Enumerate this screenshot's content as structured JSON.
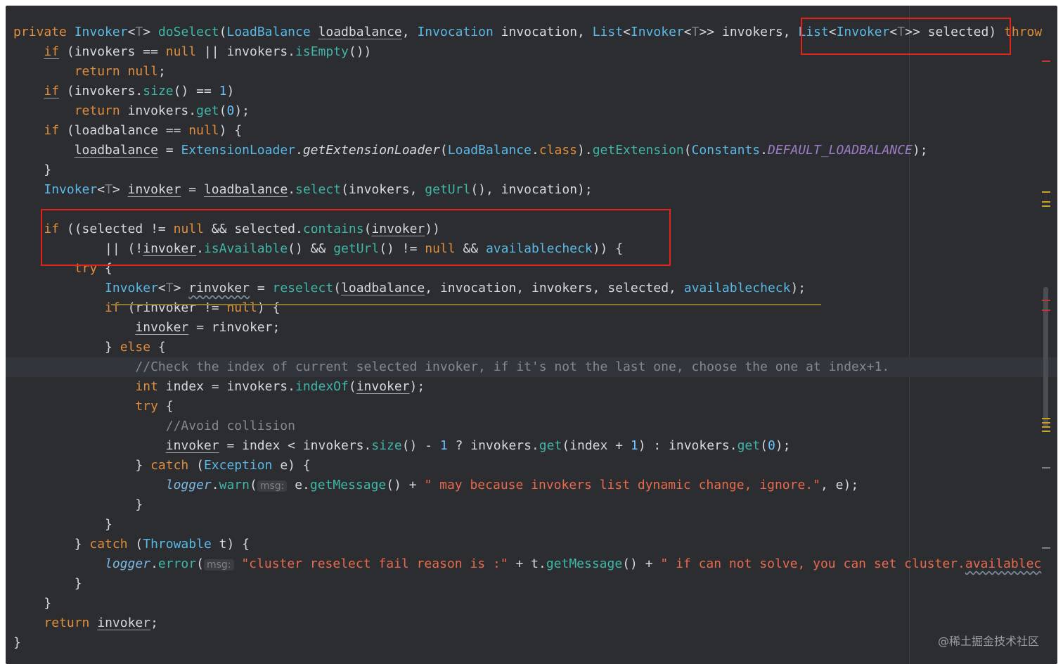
{
  "code": {
    "l01a": "private ",
    "l01b": "Invoker",
    "l01c": "<",
    "l01d": "T",
    "l01e": "> ",
    "l01f": "doSelect",
    "l01g": "(",
    "l01h": "LoadBalance",
    "l01i": " ",
    "l01j": "loadbalance",
    "l01k": ", ",
    "l01l": "Invocation",
    "l01m": " invocation, ",
    "l01n": "List",
    "l01o": "<",
    "l01p": "Invoker",
    "l01q": "<",
    "l01r": "T",
    "l01s": ">> invokers, ",
    "l01t": "List",
    "l01u": "<",
    "l01v": "Invoker",
    "l01w": "<",
    "l01x": "T",
    "l01y": ">> selected) ",
    "l01z": "throw",
    "l02a": "    ",
    "l02b": "if",
    "l02c": " (invokers == ",
    "l02d": "null",
    "l02e": " || invokers.",
    "l02f": "isEmpty",
    "l02g": "())",
    "l03a": "        ",
    "l03b": "return",
    "l03c": " ",
    "l03d": "null",
    "l03e": ";",
    "l04a": "    ",
    "l04b": "if",
    "l04c": " (invokers.",
    "l04d": "size",
    "l04e": "() == ",
    "l04f": "1",
    "l04g": ")",
    "l05a": "        ",
    "l05b": "return",
    "l05c": " invokers.",
    "l05d": "get",
    "l05e": "(",
    "l05f": "0",
    "l05g": ");",
    "l06a": "    ",
    "l06b": "if",
    "l06c": " (loadbalance == ",
    "l06d": "null",
    "l06e": ") {",
    "l07a": "        ",
    "l07b": "loadbalance",
    "l07c": " = ",
    "l07d": "ExtensionLoader",
    "l07e": ".",
    "l07f": "getExtensionLoader",
    "l07g": "(",
    "l07h": "LoadBalance",
    "l07i": ".",
    "l07j": "class",
    "l07k": ").",
    "l07l": "getExtension",
    "l07m": "(",
    "l07n": "Constants",
    "l07o": ".",
    "l07p": "DEFAULT_LOADBALANCE",
    "l07q": ");",
    "l08a": "    }",
    "l09a": "    ",
    "l09b": "Invoker",
    "l09c": "<",
    "l09d": "T",
    "l09e": "> ",
    "l09f": "invoker",
    "l09g": " = ",
    "l09h": "loadbalance",
    "l09i": ".",
    "l09j": "select",
    "l09k": "(invokers, ",
    "l09l": "getUrl",
    "l09m": "(), invocation);",
    "l11a": "    ",
    "l11b": "if",
    "l11c": " ((selected != ",
    "l11d": "null",
    "l11e": " && selected.",
    "l11f": "contains",
    "l11g": "(",
    "l11h": "invoker",
    "l11i": "))",
    "l12a": "            || (!",
    "l12b": "invoker",
    "l12c": ".",
    "l12d": "isAvailable",
    "l12e": "() && ",
    "l12f": "getUrl",
    "l12g": "() != ",
    "l12h": "null",
    "l12i": " && ",
    "l12j": "availablecheck",
    "l12k": ")) {",
    "l13a": "        ",
    "l13b": "try",
    "l13c": " {",
    "l14a": "            ",
    "l14b": "Invoker",
    "l14c": "<",
    "l14d": "T",
    "l14e": "> ",
    "l14f": "rinvoker",
    "l14g": " = ",
    "l14h": "reselect",
    "l14i": "(",
    "l14j": "loadbalance",
    "l14k": ", invocation, invokers, selected, ",
    "l14l": "availablecheck",
    "l14m": ");",
    "l15a": "            ",
    "l15b": "if",
    "l15c": " (rinvoker != ",
    "l15d": "null",
    "l15e": ") {",
    "l16a": "                ",
    "l16b": "invoker",
    "l16c": " = rinvoker;",
    "l17a": "            } ",
    "l17b": "else",
    "l17c": " {",
    "l18a": "                ",
    "l18b": "//Check the index of current selected invoker, if it's not the last one, choose the one at index+1.",
    "l19a": "                ",
    "l19b": "int",
    "l19c": " index = invokers.",
    "l19d": "indexOf",
    "l19e": "(",
    "l19f": "invoker",
    "l19g": ");",
    "l20a": "                ",
    "l20b": "try",
    "l20c": " {",
    "l21a": "                    ",
    "l21b": "//Avoid collision",
    "l22a": "                    ",
    "l22b": "invoker",
    "l22c": " = index < invokers.",
    "l22d": "size",
    "l22e": "() - ",
    "l22f": "1",
    "l22g": " ? invokers.",
    "l22h": "get",
    "l22i": "(index + ",
    "l22j": "1",
    "l22k": ") : invokers.",
    "l22l": "get",
    "l22m": "(",
    "l22n": "0",
    "l22o": ");",
    "l23a": "                } ",
    "l23b": "catch",
    "l23c": " (",
    "l23d": "Exception",
    "l23e": " e) {",
    "l24a": "                    ",
    "l24b": "logger",
    "l24c": ".",
    "l24d": "warn",
    "l24e": "(",
    "l24f": "msg:",
    "l24g": " e.",
    "l24h": "getMessage",
    "l24i": "() + ",
    "l24j": "\" may because invokers list dynamic change, ignore.\"",
    "l24k": ", e);",
    "l25a": "                }",
    "l26a": "            }",
    "l27a": "        } ",
    "l27b": "catch",
    "l27c": " (",
    "l27d": "Throwable",
    "l27e": " t) {",
    "l28a": "            ",
    "l28b": "logger",
    "l28c": ".",
    "l28d": "error",
    "l28e": "(",
    "l28f": "msg:",
    "l28g": " ",
    "l28h": "\"cluster reselect fail reason is :\"",
    "l28i": " + t.",
    "l28j": "getMessage",
    "l28k": "() + ",
    "l28l": "\" if can not solve, you can set cluster.",
    "l28m": "availablec",
    "l29a": "        }",
    "l30a": "    }",
    "l31a": "    ",
    "l31b": "return",
    "l31c": " ",
    "l31d": "invoker",
    "l31e": ";",
    "l32a": "}"
  },
  "watermark": "@稀土掘金技术社区",
  "colors": {
    "background": "#2b2d30",
    "keyword": "#e08d3c",
    "type": "#5ab8e6",
    "method": "#3fb6a8",
    "string": "#e86a4d",
    "comment": "#85898f",
    "highlight_box": "#e0241c"
  }
}
